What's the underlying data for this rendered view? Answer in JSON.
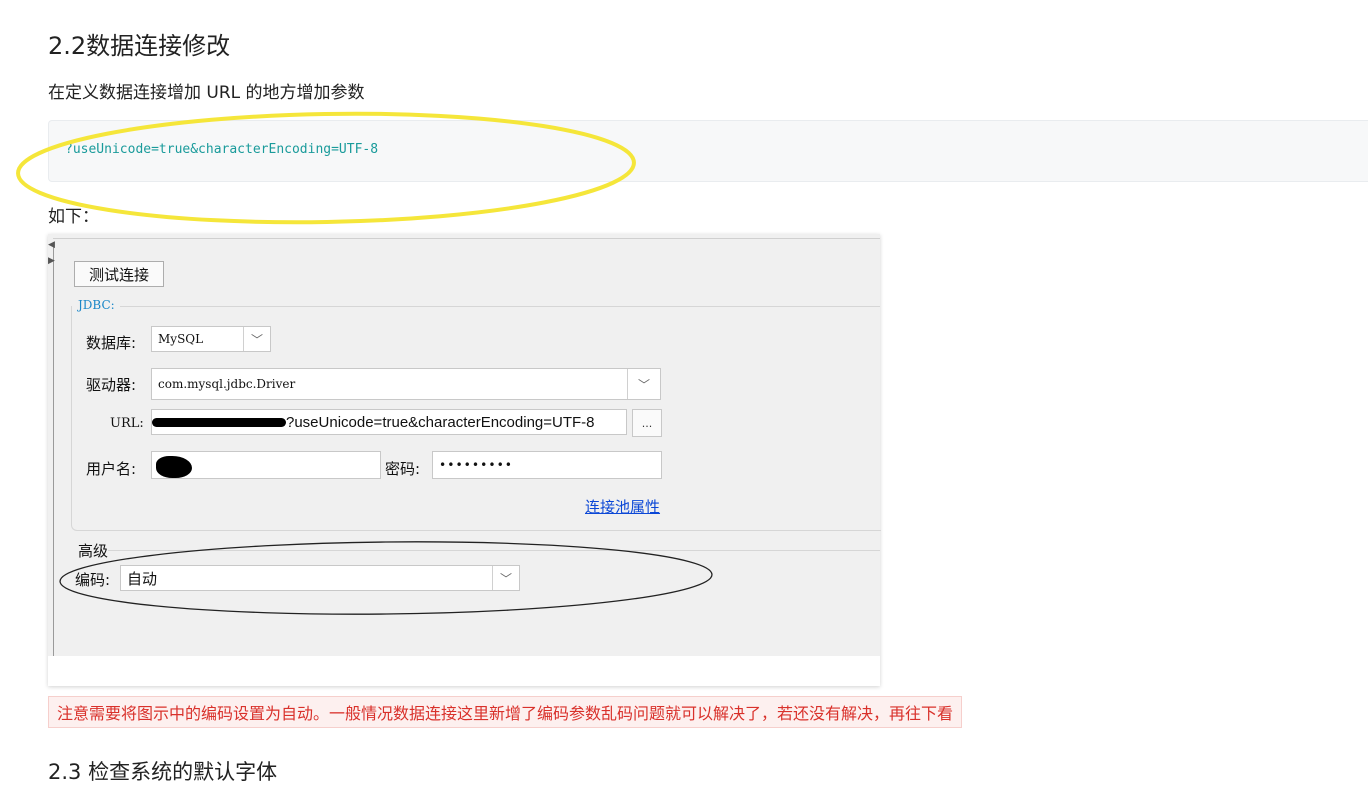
{
  "doc": {
    "heading": "2.2数据连接修改",
    "intro": "在定义数据连接增加 URL 的地方增加参数",
    "code": "?useUnicode=true&characterEncoding=UTF-8",
    "as_below": "如下：",
    "notice": "注意需要将图示中的编码设置为自动。一般情况数据连接这里新增了编码参数乱码问题就可以解决了，若还没有解决，再往下看",
    "next_heading": "2.3 检查系统的默认字体"
  },
  "dialog": {
    "test_button": "测试连接",
    "group_label": "JDBC:",
    "database_label": "数据库:",
    "database_value": "MySQL",
    "driver_label": "驱动器:",
    "driver_value": "com.mysql.jdbc.Driver",
    "url_label": "URL:",
    "url_value": "?useUnicode=true&characterEncoding=UTF-8",
    "url_more": "...",
    "username_label": "用户名:",
    "password_label": "密码:",
    "password_value": "•••••••••",
    "pool_link": "连接池属性",
    "advanced_label": "高级",
    "encoding_label": "编码:",
    "encoding_value": "自动"
  },
  "annotations": {
    "highlight_color": "#f5e63a",
    "circle_color": "#222222"
  }
}
